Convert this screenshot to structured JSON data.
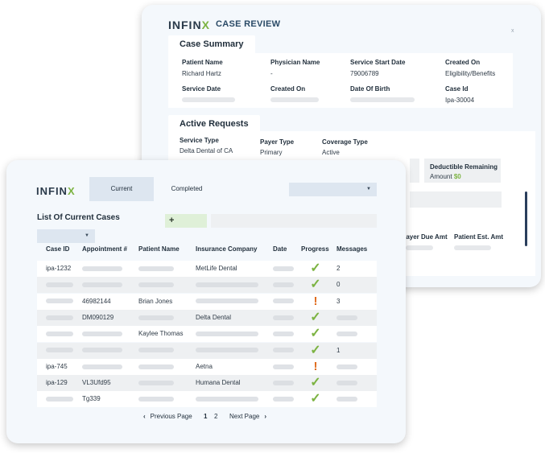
{
  "brand": {
    "logo_main": "INFIN",
    "logo_accent": "X",
    "accent_color": "#7cb342",
    "warning_color": "#e06c1e"
  },
  "case_review": {
    "title": "CASE REVIEW",
    "close": "x",
    "case_summary": {
      "heading": "Case Summary",
      "patient_name_label": "Patient Name",
      "patient_name": "Richard Hartz",
      "physician_name_label": "Physician Name",
      "physician_name": "-",
      "service_start_date_label": "Service Start Date",
      "service_start_date": "79006789",
      "created_on_label": "Created On",
      "created_on": "Eligibility/Benefits",
      "service_date_label": "Service Date",
      "created_on_label_2": "Created On",
      "date_of_birth_label": "Date Of Birth",
      "case_id_label": "Case Id",
      "case_id": "Ipa-30004"
    },
    "active_requests": {
      "heading": "Active Requests",
      "service_type_label": "Service Type",
      "service_type": "Delta Dental of CA",
      "payer_type_label": "Payer Type",
      "payer_type": "Primary",
      "coverage_type_label": "Coverage Type",
      "coverage_type": "Active",
      "deductible_label": "Deductible Remaining",
      "amount_label": "Amount",
      "amount_value": "$0",
      "payer_due_label": "Payer Due Amt",
      "patient_est_label": "Patient Est. Amt"
    }
  },
  "cases": {
    "tabs": {
      "current": "Current",
      "completed": "Completed"
    },
    "list_title": "List Of Current Cases",
    "add_label": "+",
    "columns": {
      "case_id": "Case ID",
      "appointment": "Appointment #",
      "patient": "Patient Name",
      "insurance": "Insurance Company",
      "date": "Date",
      "progress": "Progress",
      "messages": "Messages"
    },
    "rows": [
      {
        "case_id": "ipa-1232",
        "appointment": "",
        "patient": "",
        "insurance": "MetLife Dental",
        "progress": "check",
        "messages": "2"
      },
      {
        "case_id": "",
        "appointment": "",
        "patient": "",
        "insurance": "",
        "progress": "check",
        "messages": "0"
      },
      {
        "case_id": "",
        "appointment": "46982144",
        "patient": "Brian Jones",
        "insurance": "",
        "progress": "alert",
        "messages": "3"
      },
      {
        "case_id": "",
        "appointment": "DM090129",
        "patient": "",
        "insurance": "Delta Dental",
        "progress": "check",
        "messages": ""
      },
      {
        "case_id": "",
        "appointment": "",
        "patient": "Kaylee Thomas",
        "insurance": "",
        "progress": "check",
        "messages": ""
      },
      {
        "case_id": "",
        "appointment": "",
        "patient": "",
        "insurance": "",
        "progress": "check",
        "messages": "1"
      },
      {
        "case_id": "ipa-745",
        "appointment": "",
        "patient": "",
        "insurance": "Aetna",
        "progress": "alert",
        "messages": ""
      },
      {
        "case_id": "ipa-129",
        "appointment": "VL3Ufd95",
        "patient": "",
        "insurance": "Humana Dental",
        "progress": "check",
        "messages": ""
      },
      {
        "case_id": "",
        "appointment": "Tg339",
        "patient": "",
        "insurance": "",
        "progress": "check",
        "messages": ""
      }
    ],
    "pagination": {
      "prev": "Previous Page",
      "page1": "1",
      "page2": "2",
      "next": "Next Page"
    }
  }
}
